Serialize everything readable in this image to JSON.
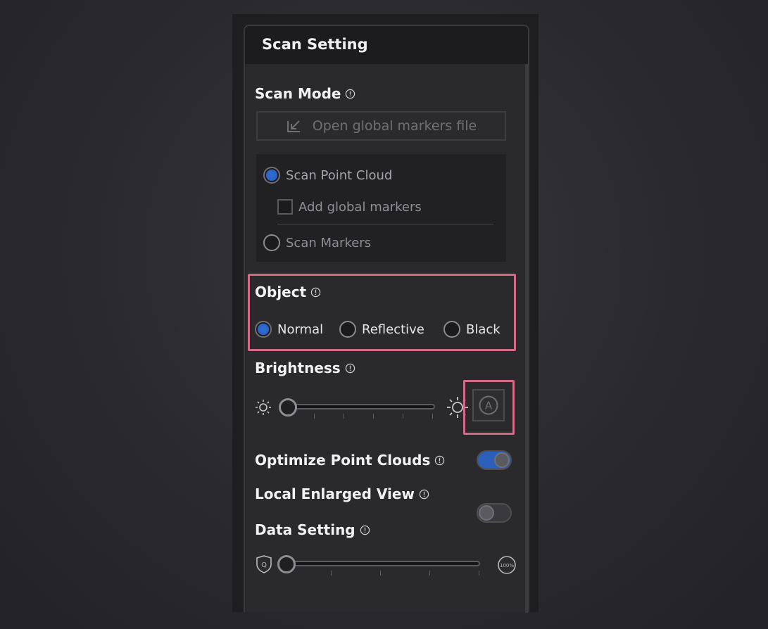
{
  "panel": {
    "title": "Scan Setting"
  },
  "scan_mode": {
    "title": "Scan Mode",
    "open_button_label": "Open global markers file",
    "options": {
      "point_cloud": "Scan Point Cloud",
      "add_global_markers": "Add  global markers",
      "markers": "Scan Markers"
    },
    "selected": "Scan Point Cloud"
  },
  "object": {
    "title": "Object",
    "options": [
      "Normal",
      "Reflective",
      "Black"
    ],
    "selected": "Normal"
  },
  "brightness": {
    "title": "Brightness",
    "value_fraction": 0.0,
    "auto_label": "A"
  },
  "optimize_point_clouds": {
    "label": "Optimize Point Clouds",
    "enabled": true
  },
  "local_enlarged_view": {
    "label": "Local Enlarged View",
    "enabled": false
  },
  "data_setting": {
    "title": "Data Setting",
    "value_fraction": 0.0,
    "min_icon_label": "Q",
    "max_icon_label": "100%"
  },
  "colors": {
    "highlight": "#d26a86",
    "accent_blue": "#2f6fd8",
    "panel_bg": "#2a2a2d"
  },
  "icons": [
    "info-icon",
    "import-arrow-icon",
    "sun-small-icon",
    "sun-large-icon",
    "auto-a-icon",
    "shield-q-icon",
    "percent-badge-icon"
  ]
}
